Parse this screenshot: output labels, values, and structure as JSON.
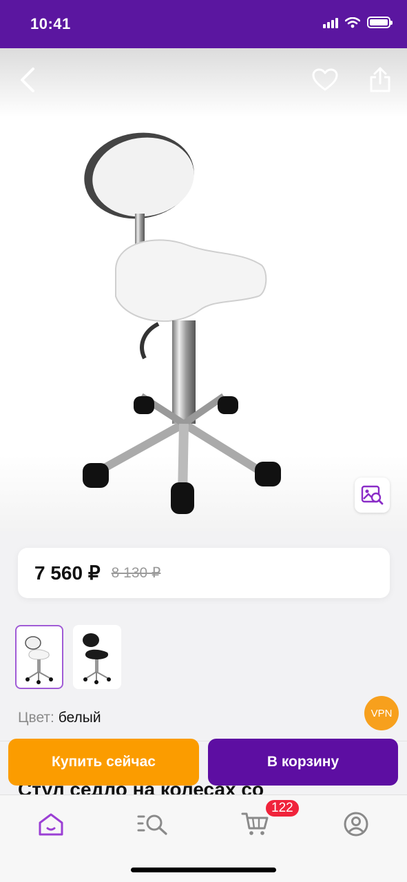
{
  "status_bar": {
    "time": "10:41"
  },
  "product": {
    "price_current": "7 560 ₽",
    "price_old": "8 130 ₽",
    "color_label": "Цвет:",
    "color_value": "белый",
    "title": "Стул седло на колесах со"
  },
  "thumbnails": [
    {
      "name": "белый",
      "selected": true
    },
    {
      "name": "черный",
      "selected": false
    }
  ],
  "vpn_badge": "VPN",
  "actions": {
    "buy_now": "Купить сейчас",
    "to_cart": "В корзину"
  },
  "tab_bar": {
    "cart_count": "122",
    "accent": "#9b3fd4"
  },
  "colors": {
    "brand": "#5b16a0",
    "buy_now": "#fb9c00",
    "to_cart": "#5d0ea2",
    "badge": "#f0233b"
  }
}
